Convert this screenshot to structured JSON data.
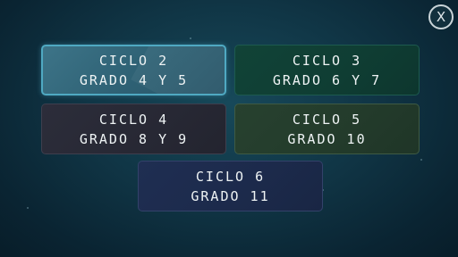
{
  "close_button": {
    "icon": "close-icon",
    "glyph": "X"
  },
  "levels": [
    {
      "line1": "CICLO 2",
      "line2": "GRADO 4 Y 5",
      "color": "#2f6275",
      "selected": true
    },
    {
      "line1": "CICLO 3",
      "line2": "GRADO 6 Y 7",
      "color": "#0f3d33",
      "selected": false
    },
    {
      "line1": "CICLO 4",
      "line2": "GRADO 8 Y 9",
      "color": "#272834",
      "selected": false
    },
    {
      "line1": "CICLO 5",
      "line2": "GRADO 10",
      "color": "#233b2b",
      "selected": false
    },
    {
      "line1": "CICLO 6",
      "line2": "GRADO 11",
      "color": "#1c2a4b",
      "selected": false
    }
  ]
}
